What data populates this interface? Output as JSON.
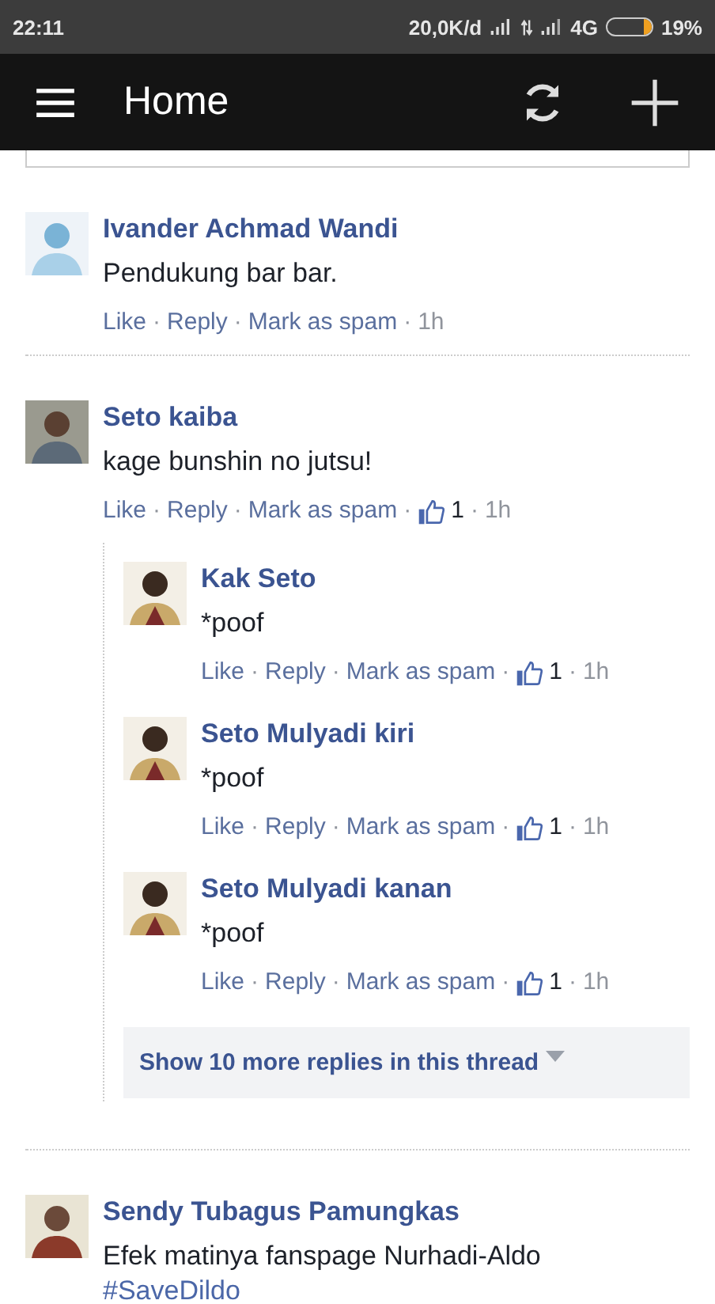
{
  "status_bar": {
    "time": "22:11",
    "network_speed": "20,0K/d",
    "network": "4G",
    "battery": "19%",
    "battery_level": {
      "level": 0.19
    }
  },
  "app_bar": {
    "title": "Home"
  },
  "separator": "·",
  "comments": [
    {
      "author": "Ivander Achmad Wandi",
      "text": "Pendukung bar bar.",
      "actions": [
        "Like",
        "Reply",
        "Mark as spam"
      ],
      "time": "1h"
    },
    {
      "author": "Seto kaiba",
      "text": "kage bunshin no jutsu!",
      "actions": [
        "Like",
        "Reply",
        "Mark as spam"
      ],
      "likes": "1",
      "time": "1h",
      "replies": [
        {
          "author": "Kak Seto",
          "text": "*poof",
          "actions": [
            "Like",
            "Reply",
            "Mark as spam"
          ],
          "likes": "1",
          "time": "1h"
        },
        {
          "author": "Seto Mulyadi kiri",
          "text": "*poof",
          "actions": [
            "Like",
            "Reply",
            "Mark as spam"
          ],
          "likes": "1",
          "time": "1h"
        },
        {
          "author": "Seto Mulyadi kanan",
          "text": "*poof",
          "actions": [
            "Like",
            "Reply",
            "Mark as spam"
          ],
          "likes": "1",
          "time": "1h"
        }
      ],
      "more_replies": "Show 10 more replies in this thread"
    },
    {
      "author": "Sendy Tubagus Pamungkas",
      "text": "Efek matinya fanspage Nurhadi-Aldo",
      "hashtag": "#SaveDildo"
    }
  ]
}
